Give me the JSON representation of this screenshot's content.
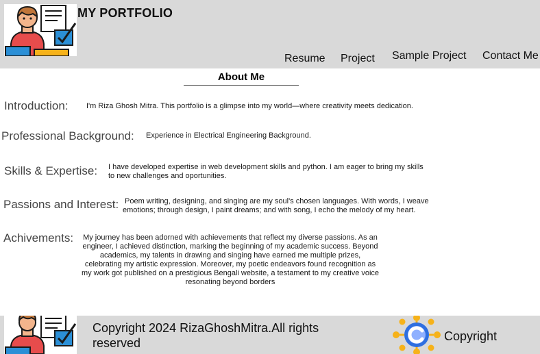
{
  "header": {
    "site_title": "MY PORTFOLIO",
    "logo_icon": "developer-at-desk-icon",
    "nav": [
      {
        "label": "Resume"
      },
      {
        "label": "Project"
      },
      {
        "label": "Sample Project"
      },
      {
        "label": "Contact Me"
      }
    ]
  },
  "about": {
    "title": "About Me",
    "rows": [
      {
        "label": "Introduction:",
        "text": "I'm Riza Ghosh Mitra.   This portfolio is a glimpse into my world—where creativity meets dedication."
      },
      {
        "label": "Professional Background:",
        "text": "Experience in Electrical Engineering Background."
      },
      {
        "label": "Skills & Expertise:",
        "text": "I have developed expertise in web development skills and python. I am eager to bring my skills to new challenges and oportunities."
      },
      {
        "label": "Passions and Interest:",
        "text": "Poem writing, designing, and singing are my soul's chosen languages. With words, I weave emotions; through design, I paint dreams; and with song, I echo the melody of my heart."
      },
      {
        "label": "Achivements:",
        "text": "My journey has been adorned with achievements that reflect my diverse passions. As an engineer, I achieved distinction, marking the beginning of my academic success. Beyond academics, my talents in drawing and singing have earned me multiple prizes, celebrating my artistic expression. Moreover, my poetic endeavors found recognition as my work got published on a prestigious Bengali website, a testament to my creative voice resonating beyond borders"
      }
    ]
  },
  "footer": {
    "copyright_line": "Copyright 2024 RizaGhoshMitra.All rights reserved",
    "badge_label": "Copyright",
    "badge_icon": "copyright-c-icon"
  },
  "colors": {
    "header_bg": "#d9d9d9",
    "footer_bg": "#d9d9d9",
    "skin": "#f3b58c",
    "shirt": "#e74c4c",
    "hair": "#c1763a",
    "blue": "#2b8fd6",
    "badge_blue": "#2f6fe0",
    "badge_orange": "#f6b21a"
  }
}
